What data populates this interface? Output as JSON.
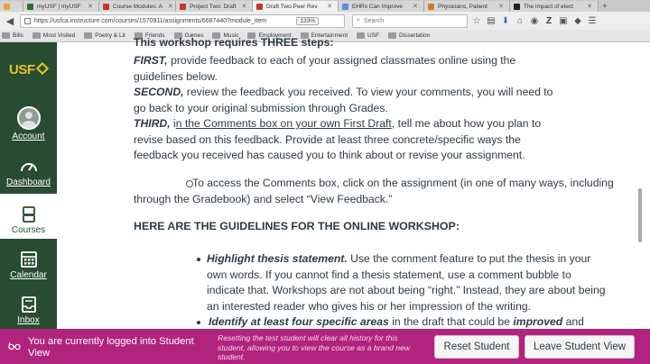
{
  "browser": {
    "tabs": [
      {
        "label": "myUSF | myUSF",
        "color": "#2f6b3b",
        "active": false
      },
      {
        "label": "Course Modules: A",
        "color": "#c0392b",
        "active": false
      },
      {
        "label": "Project Two: Draft",
        "color": "#c0392b",
        "active": false
      },
      {
        "label": "Draft Two Peer Rev",
        "color": "#c0392b",
        "active": true
      },
      {
        "label": "EHRs Can Improve",
        "color": "#5b8ad6",
        "active": false
      },
      {
        "label": "Physicians, Patient",
        "color": "#d27b2c",
        "active": false
      },
      {
        "label": "The impact of elect",
        "color": "#222222",
        "active": false
      }
    ],
    "url": "https://usfca.instructure.com/courses/1570911/assignments/6687440?module_item",
    "zoom": "133%",
    "search_placeholder": "Search",
    "bookmarks": [
      "Bills",
      "Most Visited",
      "Poetry & Lit",
      "Friends",
      "Games",
      "Music",
      "Employment",
      "Entertainment",
      "USF",
      "Dissertation"
    ]
  },
  "nav": {
    "logo": "USF",
    "items": [
      {
        "label": "Account",
        "icon": "account-avatar-icon"
      },
      {
        "label": "Dashboard",
        "icon": "dashboard-icon"
      },
      {
        "label": "Courses",
        "icon": "courses-icon"
      },
      {
        "label": "Calendar",
        "icon": "calendar-icon"
      },
      {
        "label": "Inbox",
        "icon": "inbox-icon"
      }
    ]
  },
  "content": {
    "line0": "This workshop requires THREE steps:",
    "first_label": "FIRST,",
    "first_text_1": " provide feedback to each of your assigned classmates online using the",
    "first_text_2": "guidelines below.",
    "second_label": "SECOND,",
    "second_text_1": " review the feedback you received. To view your comments, you will need to",
    "second_text_2": "go back to your original submission through Grades.",
    "third_label": "THIRD,",
    "third_pre": " i",
    "third_link": "n the Comments box on your own First Draft",
    "third_post": ", tell me about how you plan to",
    "third_text_2": "revise based on this feedback. Provide at least three concrete/specific ways the",
    "third_text_3": "feedback you received has caused you to think about or revise your assignment.",
    "access_1": "To access the Comments box, click on the assignment (in one of many ways, including",
    "access_2": "through the Gradebook) and select “View Feedback.”",
    "guidelines_heading": "HERE ARE THE GUIDELINES FOR THE ONLINE WORKSHOP:",
    "b1_label": "Highlight thesis statement.",
    "b1_text_1": " Use the comment feature to put the thesis in your",
    "b1_text_2": "own words. If you cannot find a thesis statement, use a comment bubble to",
    "b1_text_3": "indicate that. Workshops are not about being “right.” Instead, they are about being",
    "b1_text_4": "an interested reader who gives his or her impression of the writing.",
    "b2_label": "Identify at least four specific areas",
    "b2_text": " in the draft that could be ",
    "b2_emph": "improved",
    "b2_end": " and"
  },
  "student_view": {
    "message": "You are currently logged into Student View",
    "note": "Resetting the test student will clear all history for this student, allowing you to view the course as a brand new student.",
    "reset_label": "Reset Student",
    "leave_label": "Leave Student View"
  }
}
